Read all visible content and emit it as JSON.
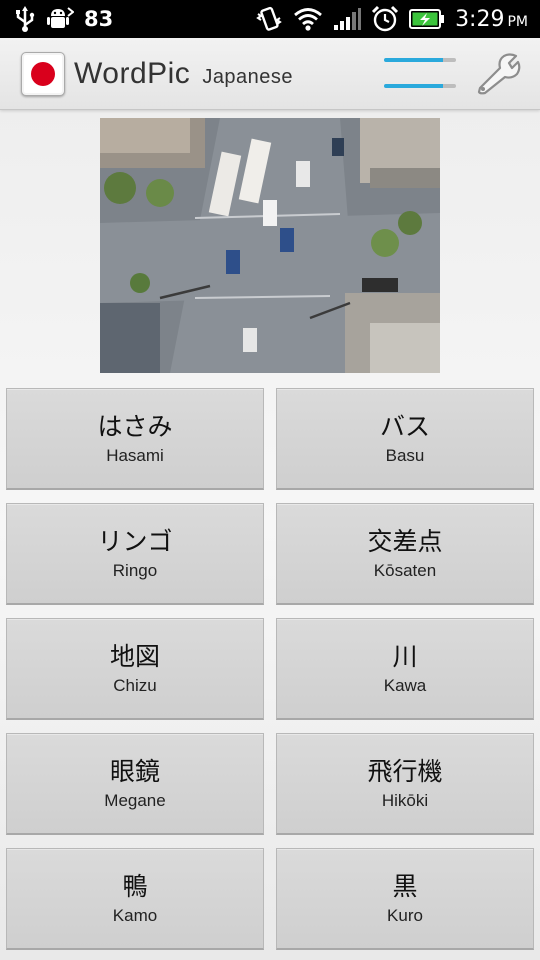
{
  "status_bar": {
    "battery_level_text": "83",
    "time": "3:29",
    "ampm": "PM",
    "battery_color": "#3cc43c",
    "icons": [
      "usb-icon",
      "android-debug-icon",
      "vibrate-icon",
      "wifi-icon",
      "signal-icon",
      "alarm-icon",
      "battery-charging-icon"
    ]
  },
  "action_bar": {
    "title": "WordPic",
    "subtitle": "Japanese",
    "flag_icon": "japan-flag-icon",
    "menu_icon": "menu-lines-icon",
    "settings_icon": "wrench-icon",
    "accent_color": "#2aa9dc"
  },
  "picture": {
    "icon": "street-intersection-photo"
  },
  "words": [
    {
      "jp": "はさみ",
      "romaji": "Hasami"
    },
    {
      "jp": "バス",
      "romaji": "Basu"
    },
    {
      "jp": "リンゴ",
      "romaji": "Ringo"
    },
    {
      "jp": "交差点",
      "romaji": "Kōsaten"
    },
    {
      "jp": "地図",
      "romaji": "Chizu"
    },
    {
      "jp": "川",
      "romaji": "Kawa"
    },
    {
      "jp": "眼鏡",
      "romaji": "Megane"
    },
    {
      "jp": "飛行機",
      "romaji": "Hikōki"
    },
    {
      "jp": "鴨",
      "romaji": "Kamo"
    },
    {
      "jp": "黒",
      "romaji": "Kuro"
    }
  ]
}
